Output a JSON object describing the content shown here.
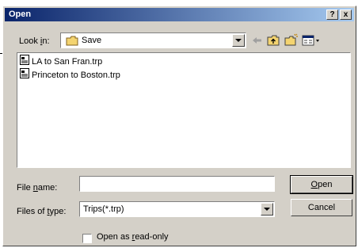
{
  "window": {
    "title": "Open",
    "help_glyph": "?",
    "close_glyph": "x"
  },
  "lookin": {
    "label": "Look in:",
    "value": "Save"
  },
  "toolbar": {
    "back_icon": "back-arrow-icon",
    "up_icon": "up-folder-icon",
    "new_folder_icon": "new-folder-icon",
    "view_icon": "view-menu-icon"
  },
  "files": [
    {
      "name": "LA to San Fran.trp",
      "icon": "document-icon"
    },
    {
      "name": "Princeton to Boston.trp",
      "icon": "document-icon"
    }
  ],
  "filename": {
    "label": "File name:",
    "value": ""
  },
  "filetype": {
    "label": "Files of type:",
    "value": "Trips(*.trp)"
  },
  "buttons": {
    "open": "Open",
    "cancel": "Cancel"
  },
  "readonly": {
    "label": "Open as read-only",
    "checked": false
  },
  "colors": {
    "face": "#d4d0c8",
    "title_start": "#0a246a",
    "title_end": "#a6caf0"
  }
}
